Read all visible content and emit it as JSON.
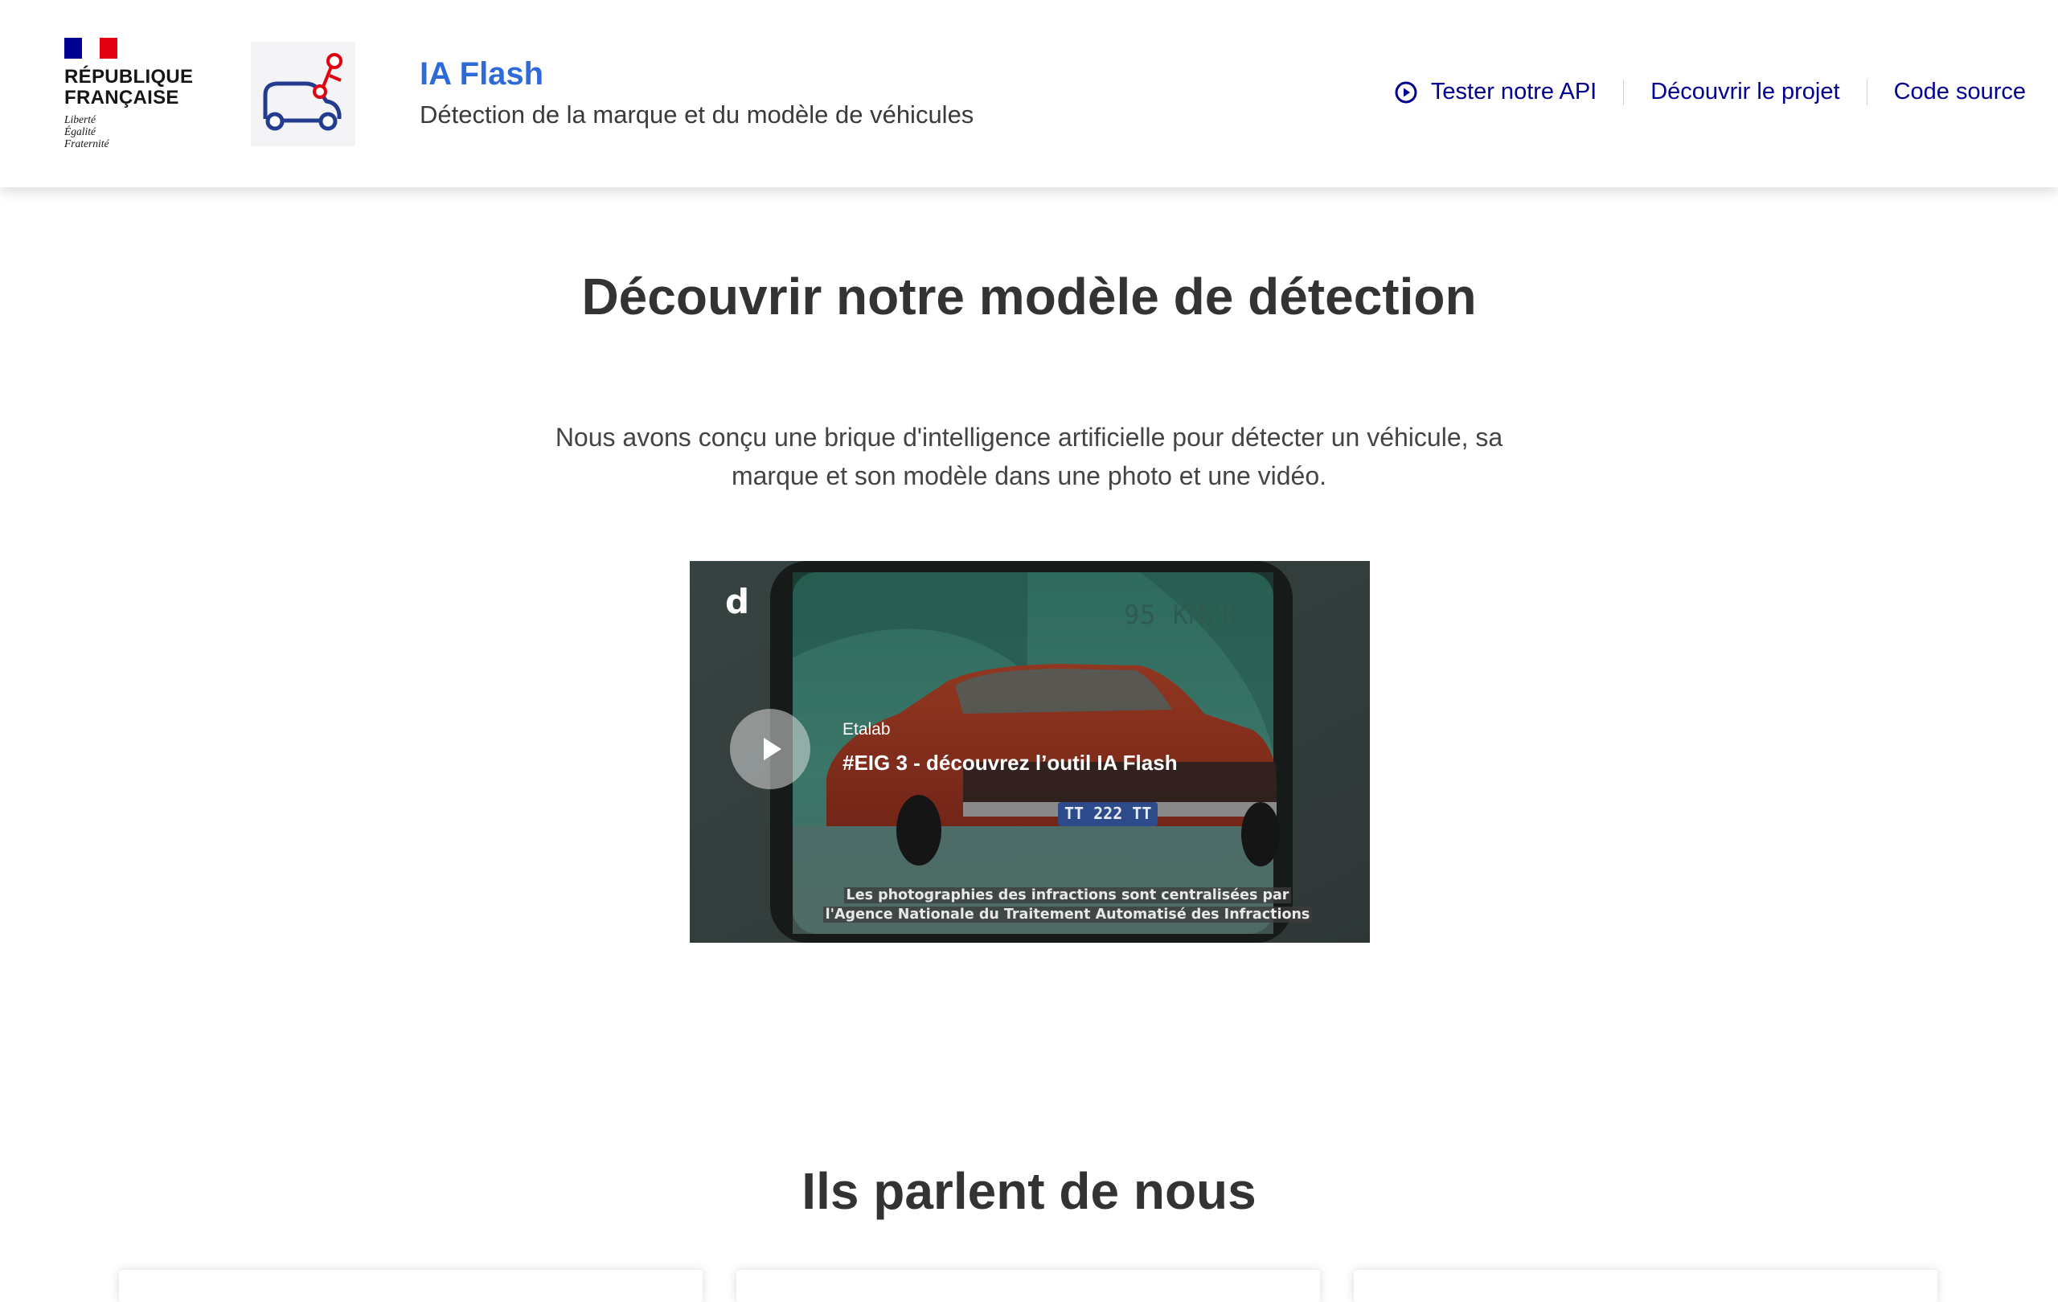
{
  "header": {
    "republique": [
      "RÉPUBLIQUE",
      "FRANÇAISE"
    ],
    "motto": [
      "Liberté",
      "Égalité",
      "Fraternité"
    ],
    "site_title": "IA Flash",
    "tagline": "Détection de la marque et du modèle de véhicules",
    "nav": [
      {
        "label": "Tester notre API",
        "icon": "play-circle-icon"
      },
      {
        "label": "Découvrir le projet"
      },
      {
        "label": "Code source"
      }
    ]
  },
  "hero": {
    "title": "Découvrir notre modèle de détection",
    "description": "Nous avons conçu une brique d'intelligence artificielle pour détecter un véhicule, sa marque et son modèle dans une photo et une vidéo."
  },
  "video": {
    "player_logo": "d",
    "channel": "Etalab",
    "title": "#EIG 3 - découvrez l’outil IA Flash",
    "speed_overlay": "95 KM/H",
    "plate": "TT 222 TT",
    "caption_lines": [
      "Les photographies des infractions sont centralisées par",
      "l'Agence Nationale du Traitement Automatisé des Infractions"
    ]
  },
  "press": {
    "title": "Ils parlent de nous"
  },
  "colors": {
    "blue_france": "#000091",
    "red_marianne": "#e1000f",
    "title_blue": "#2f6bd8"
  }
}
